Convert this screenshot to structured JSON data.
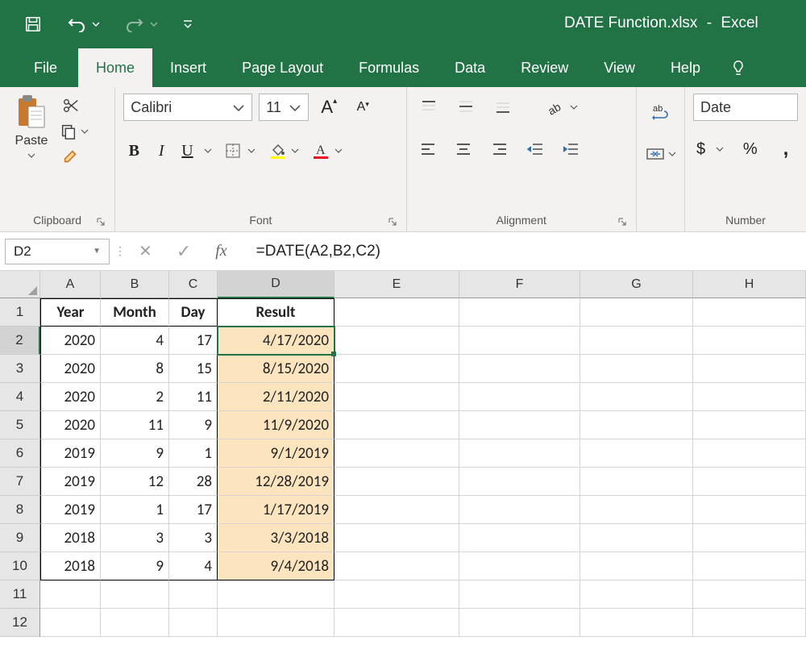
{
  "title": {
    "filename": "DATE Function.xlsx",
    "appname": "Excel",
    "dash": "-"
  },
  "qat": {
    "save": "save-icon",
    "undo": "undo-icon",
    "redo": "redo-icon",
    "customize": "customize-qat-icon"
  },
  "tabs": {
    "file": "File",
    "home": "Home",
    "insert": "Insert",
    "pagelayout": "Page Layout",
    "formulas": "Formulas",
    "data": "Data",
    "review": "Review",
    "view": "View",
    "help": "Help"
  },
  "ribbon": {
    "clipboard": {
      "label": "Clipboard",
      "paste": "Paste"
    },
    "font": {
      "label": "Font",
      "name": "Calibri",
      "size": "11",
      "increase": "A",
      "decrease": "A",
      "bold": "B",
      "italic": "I",
      "underline": "U"
    },
    "alignment": {
      "label": "Alignment",
      "wrap": "ab"
    },
    "number": {
      "label": "Number",
      "format": "Date",
      "currency": "$",
      "percent": "%",
      "comma": ","
    }
  },
  "formula_bar": {
    "name_box": "D2",
    "formula": "=DATE(A2,B2,C2)",
    "fx": "fx"
  },
  "grid": {
    "columns": [
      "A",
      "B",
      "C",
      "D",
      "E",
      "F",
      "G",
      "H"
    ],
    "row_numbers": [
      1,
      2,
      3,
      4,
      5,
      6,
      7,
      8,
      9,
      10,
      11,
      12
    ],
    "active_col": "D",
    "active_row": 2,
    "headers": {
      "A": "Year",
      "B": "Month",
      "C": "Day",
      "D": "Result"
    },
    "data": [
      {
        "A": "2020",
        "B": "4",
        "C": "17",
        "D": "4/17/2020"
      },
      {
        "A": "2020",
        "B": "8",
        "C": "15",
        "D": "8/15/2020"
      },
      {
        "A": "2020",
        "B": "2",
        "C": "11",
        "D": "2/11/2020"
      },
      {
        "A": "2020",
        "B": "11",
        "C": "9",
        "D": "11/9/2020"
      },
      {
        "A": "2019",
        "B": "9",
        "C": "1",
        "D": "9/1/2019"
      },
      {
        "A": "2019",
        "B": "12",
        "C": "28",
        "D": "12/28/2019"
      },
      {
        "A": "2019",
        "B": "1",
        "C": "17",
        "D": "1/17/2019"
      },
      {
        "A": "2018",
        "B": "3",
        "C": "3",
        "D": "3/3/2018"
      },
      {
        "A": "2018",
        "B": "9",
        "C": "4",
        "D": "9/4/2018"
      }
    ]
  }
}
